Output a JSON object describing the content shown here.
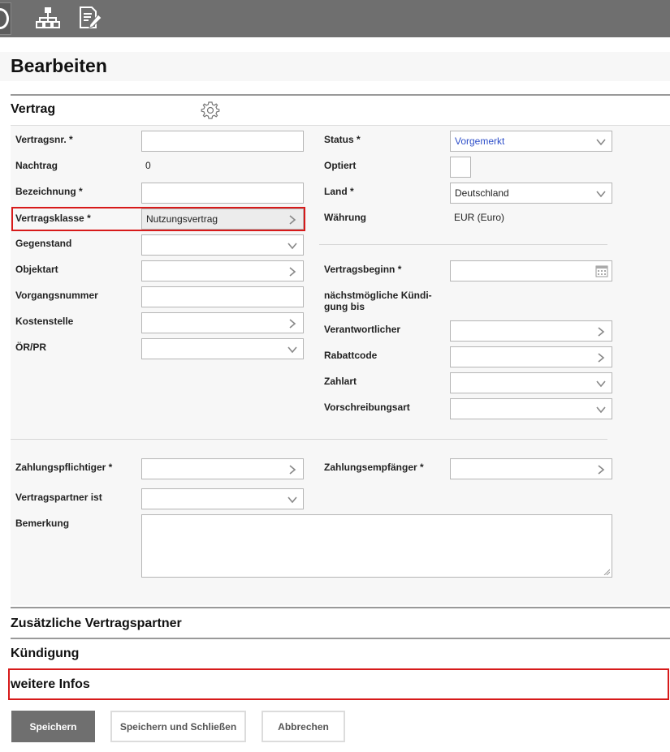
{
  "toolbar": {
    "icons": [
      "power-icon",
      "org-chart-icon",
      "edit-document-icon"
    ]
  },
  "page": {
    "title": "Bearbeiten"
  },
  "sections": {
    "vertrag": "Vertrag",
    "zusaetzliche": "Zusätzliche Vertragspartner",
    "kuendigung": "Kündigung",
    "weitere": "weitere Infos"
  },
  "left_fields": {
    "vertragsnr": {
      "label": "Vertragsnr. *",
      "value": ""
    },
    "nachtrag": {
      "label": "Nachtrag",
      "value": "0"
    },
    "bezeichnung": {
      "label": "Bezeichnung *",
      "value": ""
    },
    "vertragsklasse": {
      "label": "Vertragsklasse *",
      "value": "Nutzungsvertrag"
    },
    "gegenstand": {
      "label": "Gegenstand",
      "value": ""
    },
    "objektart": {
      "label": "Objektart",
      "value": ""
    },
    "vorgangsnummer": {
      "label": "Vorgangsnummer",
      "value": ""
    },
    "kostenstelle": {
      "label": "Kostenstelle",
      "value": ""
    },
    "oerpr": {
      "label": "ÖR/PR",
      "value": ""
    }
  },
  "right_fields": {
    "status": {
      "label": "Status *",
      "value": "Vorgemerkt"
    },
    "optiert": {
      "label": "Optiert"
    },
    "land": {
      "label": "Land *",
      "value": "Deutschland"
    },
    "waehrung": {
      "label": "Währung",
      "value": "EUR (Euro)"
    },
    "vertragsbeginn": {
      "label": "Vertragsbeginn *",
      "value": ""
    },
    "kuendigung_line1": "nächstmögliche Kündi-",
    "kuendigung_line2": "gung bis",
    "verantwortlicher": {
      "label": "Verantwortlicher",
      "value": ""
    },
    "rabattcode": {
      "label": "Rabattcode",
      "value": ""
    },
    "zahlart": {
      "label": "Zahlart",
      "value": ""
    },
    "vorschreibungsart": {
      "label": "Vorschreibungsart",
      "value": ""
    }
  },
  "payment": {
    "zahlungspflichtiger": {
      "label": "Zahlungspflichtiger *",
      "value": ""
    },
    "zahlungsempfaenger": {
      "label": "Zahlungsempfänger *",
      "value": ""
    },
    "vertragspartner_ist": {
      "label": "Vertragspartner ist",
      "value": ""
    },
    "bemerkung": {
      "label": "Bemerkung",
      "value": ""
    }
  },
  "buttons": {
    "save": "Speichern",
    "save_close": "Speichern und Schließen",
    "cancel": "Abbrechen"
  },
  "colors": {
    "toolbar": "#6f6f6f",
    "highlight": "#d71a1a",
    "status_text": "#2e4fc9"
  }
}
